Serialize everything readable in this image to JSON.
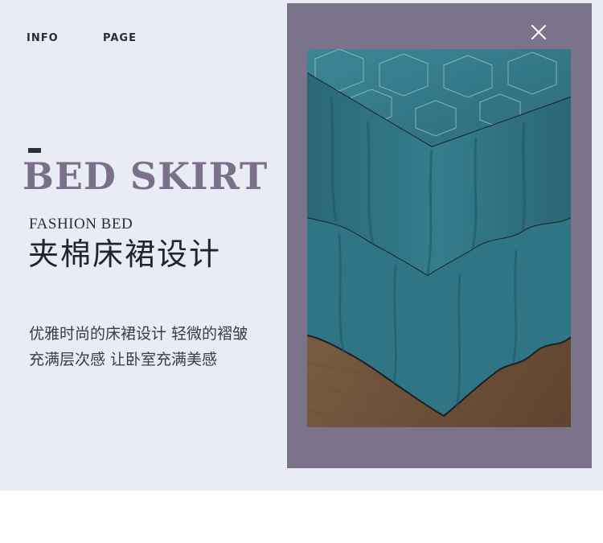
{
  "nav": {
    "info_label": "INFO",
    "page_label": "PAGE"
  },
  "hero": {
    "headline": "BED SKIRT",
    "subhead": "FASHION BED",
    "title_zh": "夹棉床裙设计",
    "description": [
      "优雅时尚的床裙设计   轻微的褶皱",
      "充满层次感   让卧室充满美感"
    ]
  },
  "colors": {
    "page_background": "#e9ecf4",
    "panel": "#7b7389",
    "headline": "#7a7089",
    "fabric": "#2e7383",
    "floor": "#7a5a3c"
  },
  "icons": {
    "close": "close-icon"
  }
}
